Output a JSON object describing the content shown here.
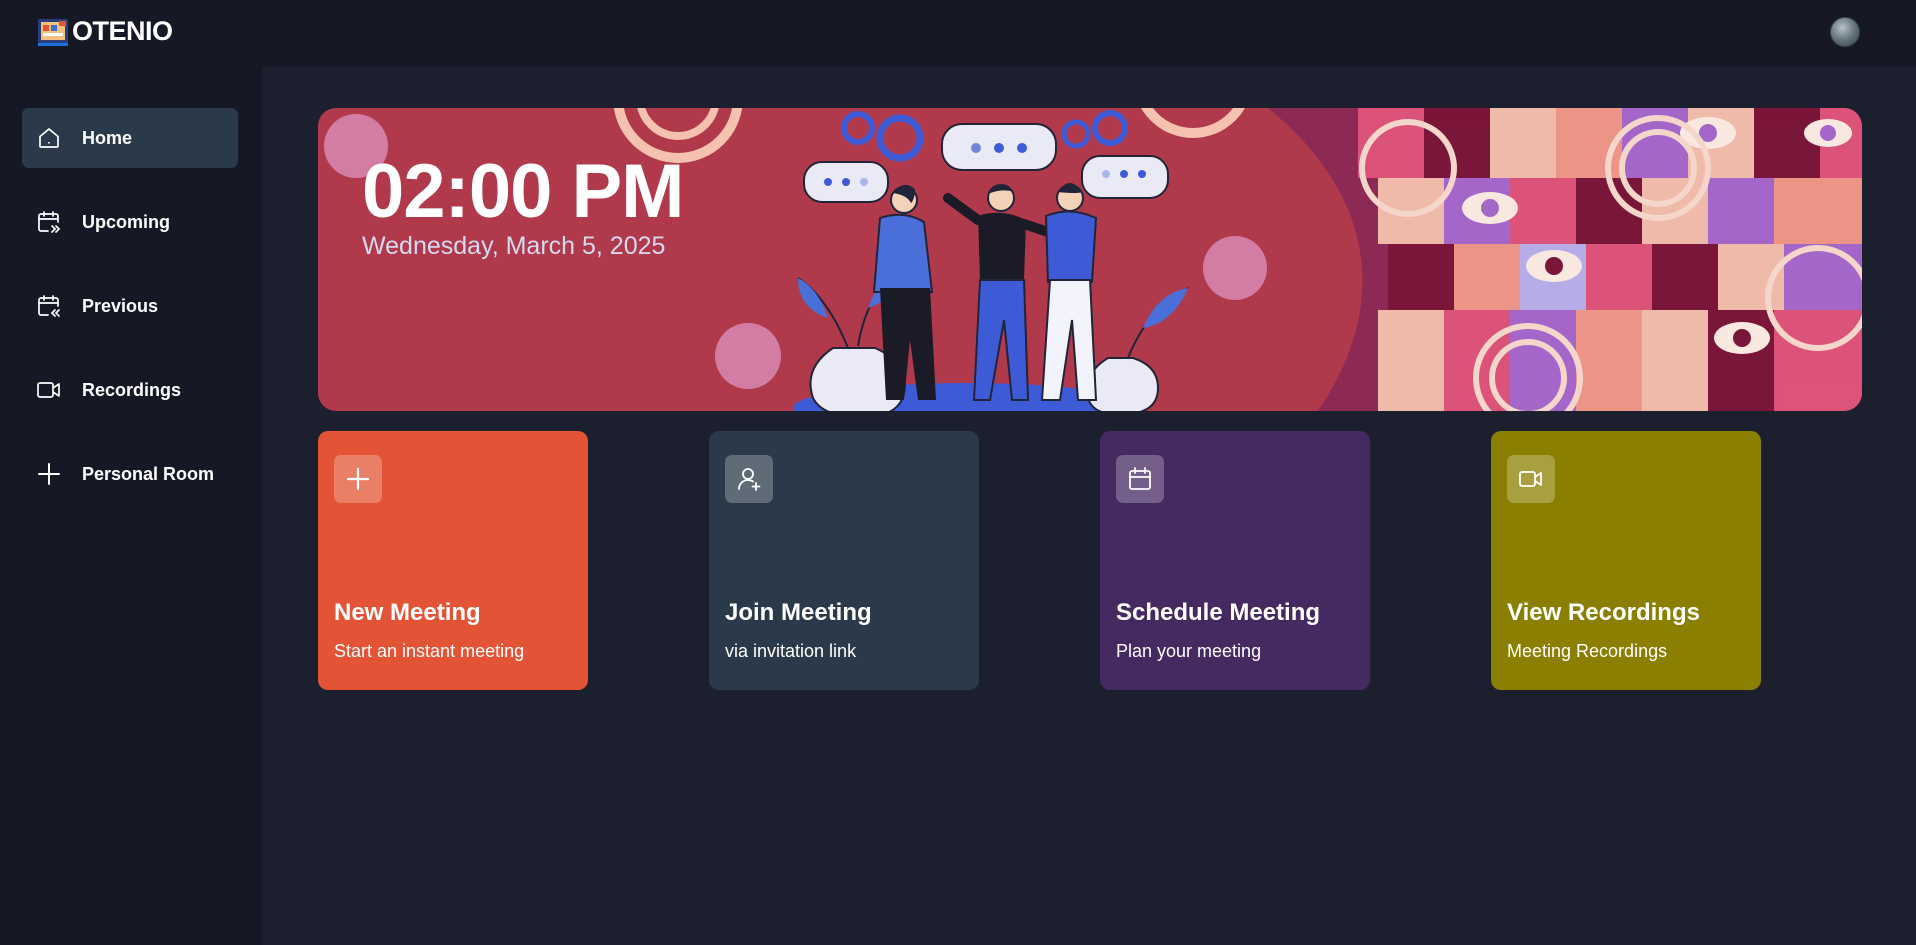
{
  "app": {
    "name": "OTENIO"
  },
  "sidebar": {
    "items": [
      {
        "label": "Home",
        "icon": "home-icon",
        "active": true
      },
      {
        "label": "Upcoming",
        "icon": "calendar-forward-icon",
        "active": false
      },
      {
        "label": "Previous",
        "icon": "calendar-back-icon",
        "active": false
      },
      {
        "label": "Recordings",
        "icon": "video-icon",
        "active": false
      },
      {
        "label": "Personal Room",
        "icon": "plus-icon",
        "active": false
      }
    ]
  },
  "banner": {
    "time": "02:00 PM",
    "date": "Wednesday, March 5, 2025"
  },
  "cards": [
    {
      "title": "New Meeting",
      "subtitle": "Start an instant meeting",
      "icon": "plus-icon",
      "color": "#e35436"
    },
    {
      "title": "Join Meeting",
      "subtitle": "via invitation link",
      "icon": "user-add-icon",
      "color": "#2a3a4a"
    },
    {
      "title": "Schedule Meeting",
      "subtitle": "Plan your meeting",
      "icon": "calendar-icon",
      "color": "#452a62"
    },
    {
      "title": "View Recordings",
      "subtitle": "Meeting Recordings",
      "icon": "video-icon",
      "color": "#8a7f00"
    }
  ],
  "colors": {
    "background": "#1c1f2e",
    "sidebar": "#161925",
    "active_nav": "#2b3a4b",
    "banner": "#b03a4c"
  }
}
